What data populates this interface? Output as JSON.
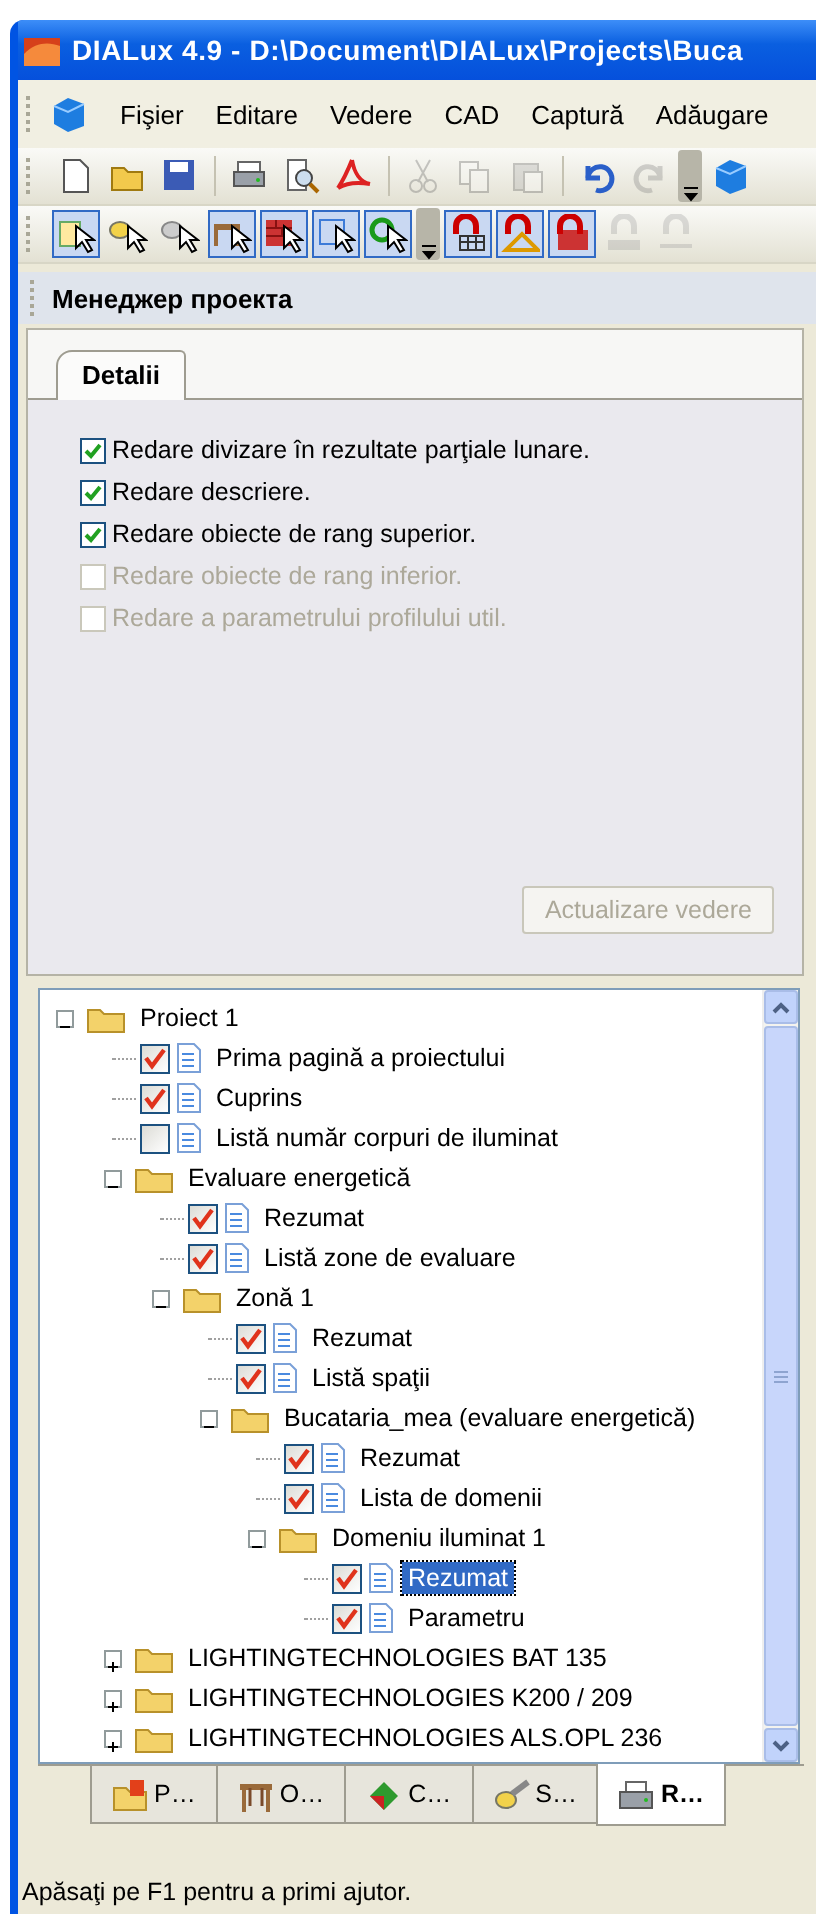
{
  "window": {
    "title": "DIALux 4.9 - D:\\Document\\DIALux\\Projects\\Buca"
  },
  "menu": [
    {
      "label": "Fişier"
    },
    {
      "label": "Editare"
    },
    {
      "label": "Vedere"
    },
    {
      "label": "CAD"
    },
    {
      "label": "Captură"
    },
    {
      "label": "Adăugare"
    }
  ],
  "toolbars": [
    {
      "buttons": [
        {
          "kind": "new",
          "disabled": false
        },
        {
          "kind": "open",
          "disabled": false
        },
        {
          "kind": "save",
          "disabled": false
        },
        {
          "kind": "separator"
        },
        {
          "kind": "print",
          "disabled": false
        },
        {
          "kind": "preview",
          "disabled": false
        },
        {
          "kind": "pdf",
          "disabled": false
        },
        {
          "kind": "separator"
        },
        {
          "kind": "cut",
          "disabled": true
        },
        {
          "kind": "copy",
          "disabled": true
        },
        {
          "kind": "paste",
          "disabled": true
        },
        {
          "kind": "separator"
        },
        {
          "kind": "undo",
          "disabled": false
        },
        {
          "kind": "redo",
          "disabled": true
        },
        {
          "kind": "overflow"
        },
        {
          "kind": "cube",
          "disabled": false
        }
      ]
    },
    {
      "buttons": [
        {
          "kind": "select-room",
          "selected": true
        },
        {
          "kind": "select-lamp",
          "selected": false
        },
        {
          "kind": "select-spot",
          "selected": false
        },
        {
          "kind": "select-table",
          "selected": true
        },
        {
          "kind": "select-wall",
          "selected": true
        },
        {
          "kind": "select-area",
          "selected": true
        },
        {
          "kind": "select-point",
          "selected": true
        },
        {
          "kind": "overflow"
        },
        {
          "kind": "grid-magnet",
          "selected": true
        },
        {
          "kind": "ruler-magnet",
          "selected": true
        },
        {
          "kind": "wall-magnet",
          "selected": true
        },
        {
          "kind": "dxf-magnet",
          "selected": false,
          "disabled": true
        },
        {
          "kind": "line-magnet",
          "selected": false,
          "disabled": true
        }
      ]
    }
  ],
  "panel": {
    "title": "Менеджер проекта",
    "tabs": [
      {
        "label": "Detalii",
        "selected": true
      }
    ],
    "options": [
      {
        "label": "Redare divizare în rezultate parţiale lunare.",
        "checked": true,
        "disabled": false
      },
      {
        "label": "Redare descriere.",
        "checked": true,
        "disabled": false
      },
      {
        "label": "Redare obiecte de rang superior.",
        "checked": true,
        "disabled": false
      },
      {
        "label": "Redare obiecte de rang inferior.",
        "checked": false,
        "disabled": true
      },
      {
        "label": "Redare a parametrului profilului util.",
        "checked": false,
        "disabled": true
      }
    ],
    "button": {
      "label": "Actualizare vedere",
      "disabled": true
    }
  },
  "tree": [
    {
      "kind": "folder",
      "label": "Proiect 1",
      "expanded": true,
      "selected": false,
      "children": [
        {
          "kind": "page",
          "label": "Prima pagină a proiectului",
          "checked": true,
          "selected": false
        },
        {
          "kind": "page",
          "label": "Cuprins",
          "checked": true,
          "selected": false
        },
        {
          "kind": "page",
          "label": "Listă număr corpuri de iluminat",
          "checked": false,
          "selected": false
        },
        {
          "kind": "folder",
          "label": "Evaluare energetică",
          "expanded": true,
          "selected": false,
          "children": [
            {
              "kind": "page",
              "label": "Rezumat",
              "checked": true,
              "selected": false
            },
            {
              "kind": "page",
              "label": "Listă zone de evaluare",
              "checked": true,
              "selected": false
            },
            {
              "kind": "folder",
              "label": "Zonă 1",
              "expanded": true,
              "selected": false,
              "children": [
                {
                  "kind": "page",
                  "label": "Rezumat",
                  "checked": true,
                  "selected": false
                },
                {
                  "kind": "page",
                  "label": "Listă spaţii",
                  "checked": true,
                  "selected": false
                },
                {
                  "kind": "folder",
                  "label": "Bucataria_mea (evaluare energetică)",
                  "expanded": true,
                  "selected": false,
                  "children": [
                    {
                      "kind": "page",
                      "label": "Rezumat",
                      "checked": true,
                      "selected": false
                    },
                    {
                      "kind": "page",
                      "label": "Lista de domenii",
                      "checked": true,
                      "selected": false
                    },
                    {
                      "kind": "folder",
                      "label": "Domeniu iluminat 1",
                      "expanded": true,
                      "selected": false,
                      "children": [
                        {
                          "kind": "page",
                          "label": "Rezumat",
                          "checked": true,
                          "selected": true
                        },
                        {
                          "kind": "page",
                          "label": "Parametru",
                          "checked": true,
                          "selected": false
                        }
                      ]
                    }
                  ]
                }
              ]
            }
          ]
        },
        {
          "kind": "folder",
          "label": "LIGHTINGTECHNOLOGIES  BAT 135",
          "expanded": false,
          "selected": false
        },
        {
          "kind": "folder",
          "label": "LIGHTINGTECHNOLOGIES  K200 / 209",
          "expanded": false,
          "selected": false
        },
        {
          "kind": "folder",
          "label": "LIGHTINGTECHNOLOGIES  ALS.OPL 236",
          "expanded": false,
          "selected": false
        }
      ]
    }
  ],
  "bottom_tabs": [
    {
      "kind": "project",
      "label": "P…",
      "selected": false
    },
    {
      "kind": "objects",
      "label": "O…",
      "selected": false
    },
    {
      "kind": "colors",
      "label": "C…",
      "selected": false
    },
    {
      "kind": "lights",
      "label": "S…",
      "selected": false
    },
    {
      "kind": "output",
      "label": "R…",
      "selected": true
    }
  ],
  "status_bar": "Apăsaţi pe F1 pentru a primi ajutor."
}
